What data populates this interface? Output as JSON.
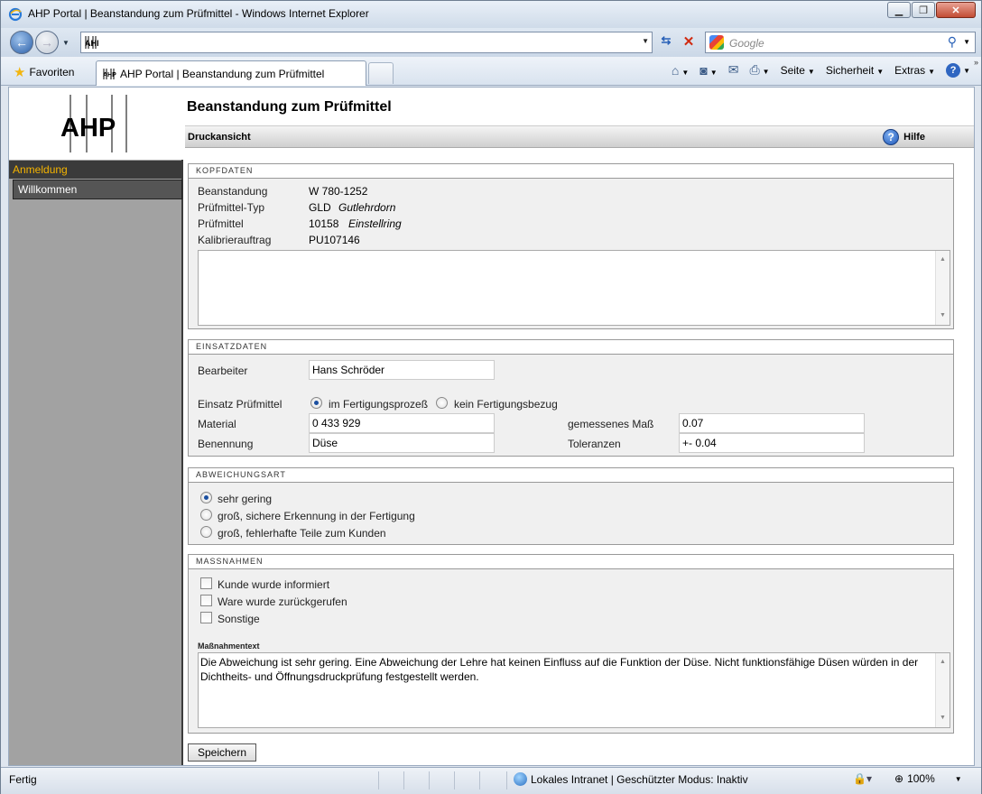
{
  "window": {
    "title": "AHP Portal | Beanstandung zum Prüfmittel - Windows Internet Explorer"
  },
  "browser": {
    "address_value": "",
    "search_placeholder": "Google",
    "favorites_label": "Favoriten",
    "tab_title": "AHP Portal | Beanstandung zum Prüfmittel",
    "commands": {
      "page": "Seite",
      "security": "Sicherheit",
      "extras": "Extras"
    }
  },
  "sidebar": {
    "logo_text": "AHP",
    "section": "Anmeldung",
    "items": [
      {
        "label": "Willkommen"
      }
    ]
  },
  "page": {
    "title": "Beanstandung zum Prüfmittel",
    "print_label": "Druckansicht",
    "help_label": "Hilfe"
  },
  "kopfdaten": {
    "legend": "KOPFDATEN",
    "rows": [
      {
        "label": "Beanstandung",
        "value": "W 780-1252",
        "extra": ""
      },
      {
        "label": "Prüfmittel-Typ",
        "value": "GLD",
        "extra": "Gutlehrdorn"
      },
      {
        "label": "Prüfmittel",
        "value": "10158",
        "extra": "Einstellring"
      },
      {
        "label": "Kalibrierauftrag",
        "value": "PU107146",
        "extra": ""
      }
    ],
    "notes": ""
  },
  "einsatzdaten": {
    "legend": "EINSATZDATEN",
    "bearbeiter_label": "Bearbeiter",
    "bearbeiter_value": "Hans Schröder",
    "einsatz_label": "Einsatz Prüfmittel",
    "option_1": "im Fertigungsprozeß",
    "option_2": "kein Fertigungsbezug",
    "material_label": "Material",
    "material_value": "0 433 929",
    "benennung_label": "Benennung",
    "benennung_value": "Düse",
    "mass_label": "gemessenes Maß",
    "mass_value": "0.07",
    "toleranz_label": "Toleranzen",
    "toleranz_value": "+- 0.04"
  },
  "abweichungsart": {
    "legend": "ABWEICHUNGSART",
    "options": [
      {
        "label": "sehr gering",
        "selected": true
      },
      {
        "label": "groß, sichere Erkennung in der Fertigung",
        "selected": false
      },
      {
        "label": "groß, fehlerhafte Teile zum Kunden",
        "selected": false
      }
    ]
  },
  "massnahmen": {
    "legend": "MASSNAHMEN",
    "checks": [
      {
        "label": "Kunde wurde informiert",
        "checked": false
      },
      {
        "label": "Ware wurde zurückgerufen",
        "checked": false
      },
      {
        "label": "Sonstige",
        "checked": false
      }
    ],
    "text_label": "Maßnahmentext",
    "text_value": "Die Abweichung ist sehr gering. Eine Abweichung der Lehre hat keinen Einfluss auf die Funktion der Düse. Nicht funktionsfähige Düsen würden in der Dichtheits- und Öffnungsdruckprüfung festgestellt werden."
  },
  "save_label": "Speichern",
  "status": {
    "text": "Fertig",
    "zone": "Lokales Intranet | Geschützter Modus: Inaktiv",
    "zoom": "100%"
  }
}
